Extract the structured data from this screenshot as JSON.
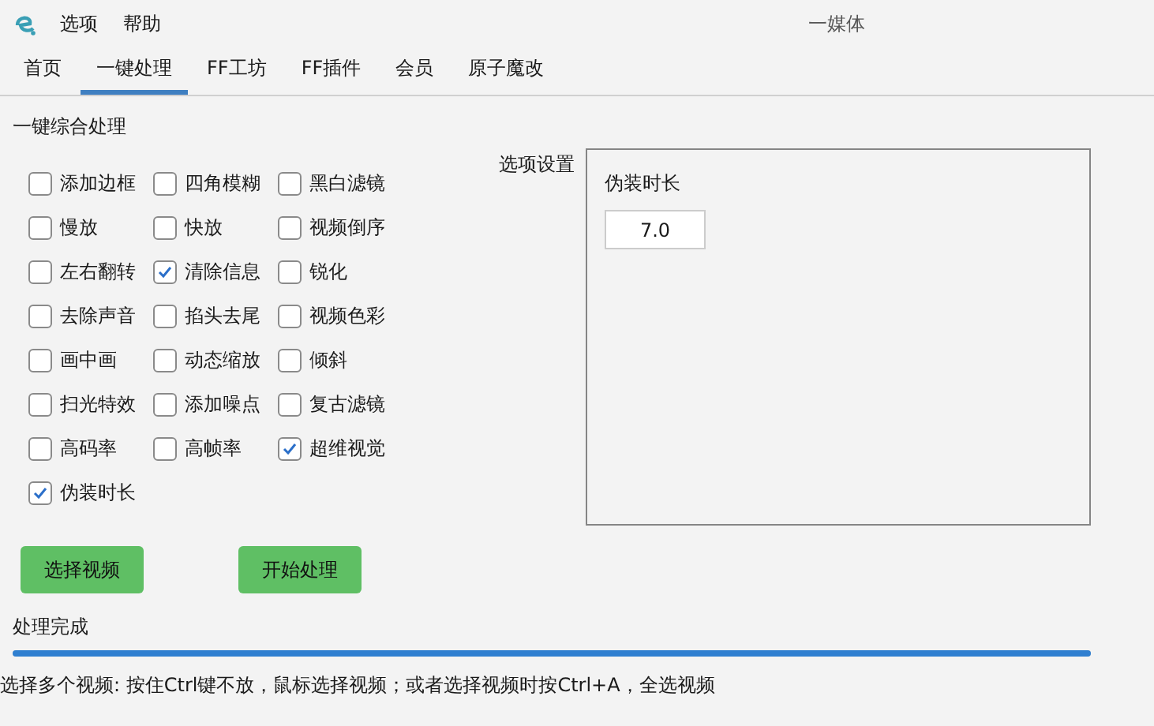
{
  "menu": [
    "选项",
    "帮助"
  ],
  "window": {
    "title": "一媒体"
  },
  "tabs": [
    {
      "label": "首页",
      "selected": false
    },
    {
      "label": "一键处理",
      "selected": true
    },
    {
      "label": "FF工坊",
      "selected": false
    },
    {
      "label": "FF插件",
      "selected": false
    },
    {
      "label": "会员",
      "selected": false
    },
    {
      "label": "原子魔改",
      "selected": false
    }
  ],
  "section_title": "一键综合处理",
  "options": [
    {
      "label": "添加边框",
      "checked": false
    },
    {
      "label": "四角模糊",
      "checked": false
    },
    {
      "label": "黑白滤镜",
      "checked": false
    },
    {
      "label": "慢放",
      "checked": false
    },
    {
      "label": "快放",
      "checked": false
    },
    {
      "label": "视频倒序",
      "checked": false
    },
    {
      "label": "左右翻转",
      "checked": false
    },
    {
      "label": "清除信息",
      "checked": true
    },
    {
      "label": "锐化",
      "checked": false
    },
    {
      "label": "去除声音",
      "checked": false
    },
    {
      "label": "掐头去尾",
      "checked": false
    },
    {
      "label": "视频色彩",
      "checked": false
    },
    {
      "label": "画中画",
      "checked": false
    },
    {
      "label": "动态缩放",
      "checked": false
    },
    {
      "label": "倾斜",
      "checked": false
    },
    {
      "label": "扫光特效",
      "checked": false
    },
    {
      "label": "添加噪点",
      "checked": false
    },
    {
      "label": "复古滤镜",
      "checked": false
    },
    {
      "label": "高码率",
      "checked": false
    },
    {
      "label": "高帧率",
      "checked": false
    },
    {
      "label": "超维视觉",
      "checked": true
    },
    {
      "label": "伪装时长",
      "checked": true
    }
  ],
  "settings": {
    "title": "选项设置",
    "field_label": "伪装时长",
    "value": "7.0"
  },
  "buttons": [
    "选择视频",
    "开始处理"
  ],
  "status": "处理完成",
  "progress": {
    "level": 1
  },
  "hint": "选择多个视频: 按住Ctrl键不放，鼠标选择视频；或者选择视频时按Ctrl+A，全选视频"
}
